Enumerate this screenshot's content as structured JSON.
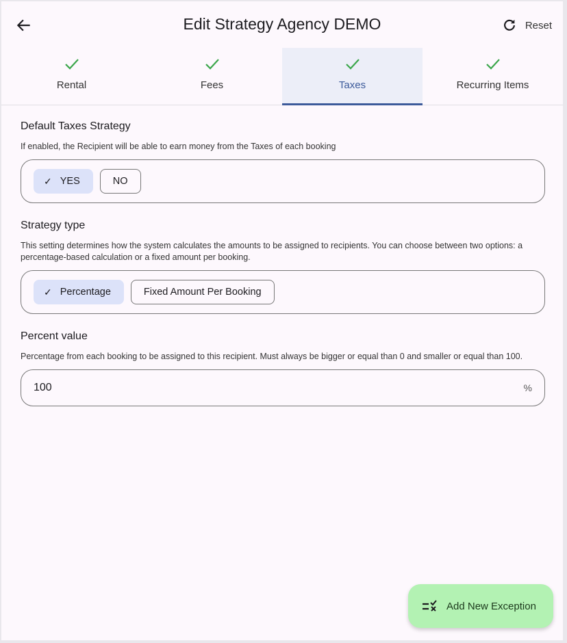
{
  "header": {
    "title": "Edit Strategy Agency DEMO",
    "reset_label": "Reset"
  },
  "tabs": [
    {
      "label": "Rental",
      "done": true
    },
    {
      "label": "Fees",
      "done": true
    },
    {
      "label": "Taxes",
      "done": true,
      "active": true
    },
    {
      "label": "Recurring Items",
      "done": true
    }
  ],
  "default_taxes": {
    "title": "Default Taxes Strategy",
    "description": "If enabled, the Recipient will be able to earn money from the Taxes of each booking",
    "options": [
      "YES",
      "NO"
    ],
    "selected": "YES"
  },
  "strategy_type": {
    "title": "Strategy type",
    "description": "This setting determines how the system calculates the amounts to be assigned to recipients. You can choose between two options: a percentage-based calculation or a fixed amount per booking.",
    "options": [
      "Percentage",
      "Fixed Amount Per Booking"
    ],
    "selected": "Percentage"
  },
  "percent_value": {
    "title": "Percent value",
    "description": "Percentage from each booking to be assigned to this recipient. Must always be bigger or equal than 0 and smaller or equal than 100.",
    "value": "100",
    "unit": "%"
  },
  "fab": {
    "label": "Add New Exception"
  },
  "colors": {
    "accent": "#3c5a9a",
    "check": "#3aa64a",
    "fab": "#b3f2b3",
    "chip_selected": "#dce2f9"
  }
}
